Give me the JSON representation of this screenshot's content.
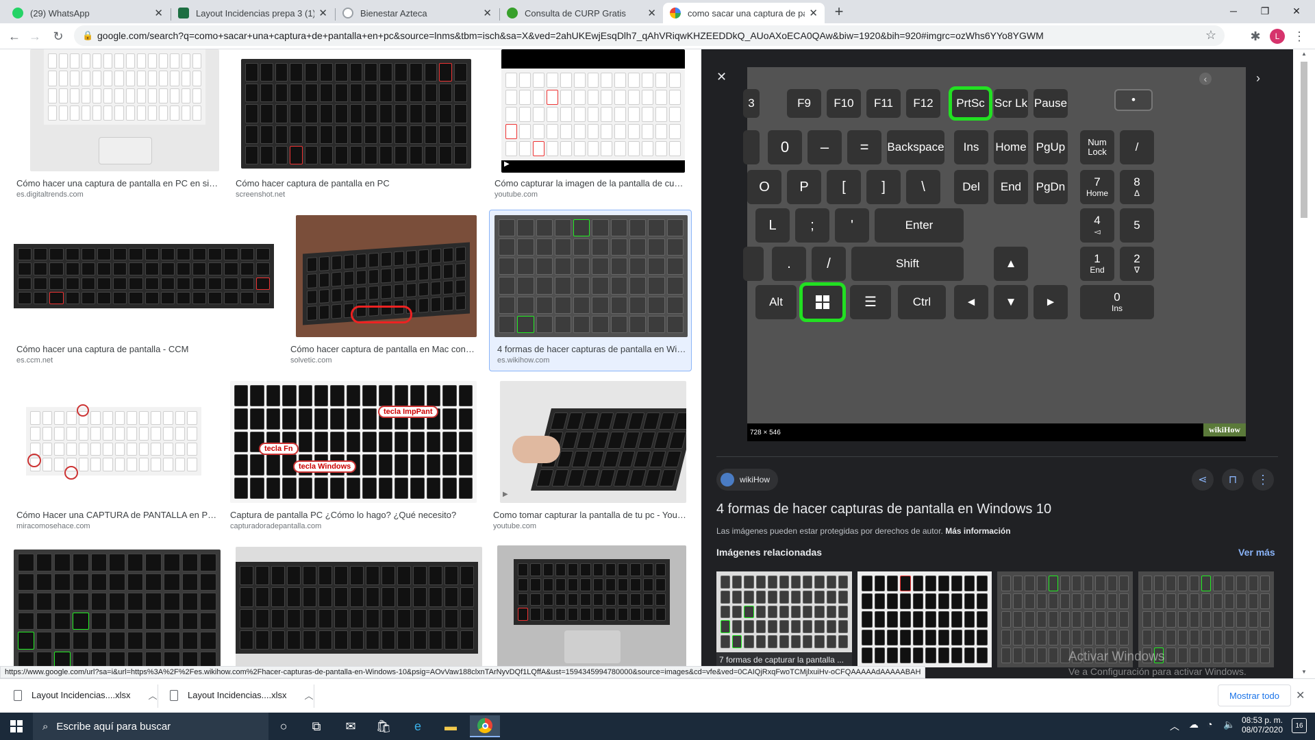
{
  "tabs": [
    {
      "label": "(29) WhatsApp",
      "favicon": "whatsapp-icon",
      "color": "#25d366"
    },
    {
      "label": "Layout Incidencias prepa 3 (1).xls",
      "favicon": "excel-icon",
      "color": "#1d6f42"
    },
    {
      "label": "Bienestar Azteca",
      "favicon": "generic-page-icon",
      "color": "#9aa0a6"
    },
    {
      "label": "Consulta de CURP Gratis",
      "favicon": "globe-icon",
      "color": "#37a02b"
    },
    {
      "label": "como sacar una captura de panta",
      "favicon": "google-icon",
      "color": "#4285f4"
    }
  ],
  "url": "google.com/search?q=como+sacar+una+captura+de+pantalla+en+pc&source=lnms&tbm=isch&sa=X&ved=2ahUKEwjEsqDlh7_qAhVRiqwKHZEEDDkQ_AUoAXoECA0QAw&biw=1920&bih=920#imgrc=ozWhs6YYo8YGWM",
  "profile_initial": "L",
  "results": [
    {
      "title": "Cómo hacer una captura de pantalla en PC en simp...",
      "source": "es.digitaltrends.com"
    },
    {
      "title": "Cómo hacer captura de pantalla en PC",
      "source": "screenshot.net"
    },
    {
      "title": "Cómo capturar la imagen de la pantalla de cualq...",
      "source": "youtube.com"
    },
    {
      "title": "Cómo hacer una captura de pantalla - CCM",
      "source": "es.ccm.net"
    },
    {
      "title": "Cómo hacer captura de pantalla en Mac con tec...",
      "source": "solvetic.com"
    },
    {
      "title": "4 formas de hacer capturas de pantalla en Wind...",
      "source": "es.wikihow.com"
    },
    {
      "title": "Cómo Hacer una CAPTURA de PANTALLA en PC ...",
      "source": "miracomosehace.com"
    },
    {
      "title": "Captura de pantalla PC ¿Cómo lo hago? ¿Qué necesito?",
      "source": "capturadoradepantalla.com"
    },
    {
      "title": "Como tomar capturar la pantalla de tu pc - YouTu...",
      "source": "youtube.com"
    }
  ],
  "thumb_labels": {
    "impr": "tecla ImpPant",
    "fn": "tecla Fn",
    "win": "tecla Windows"
  },
  "panel": {
    "image_size": "728 × 546",
    "watermark": "wikiHow",
    "site": "wikiHow",
    "title": "4 formas de hacer capturas de pantalla en Windows 10",
    "copyright": "Las imágenes pueden estar protegidas por derechos de autor.",
    "more_info": "Más información",
    "related_heading": "Imágenes relacionadas",
    "see_more": "Ver más",
    "related_caption": "7 formas de capturar la pantalla ..."
  },
  "keys": {
    "row1": [
      "3",
      "F9",
      "F10",
      "F11",
      "F12",
      "PrtSc",
      "Scr Lk",
      "Pause"
    ],
    "backspace": "Backspace",
    "ins": "Ins",
    "home": "Home",
    "pgup": "PgUp",
    "numlock": "Num Lock",
    "slash": "/",
    "del": "Del",
    "end": "End",
    "pgdn": "PgDn",
    "enter": "Enter",
    "shift": "Shift",
    "alt": "Alt",
    "ctrl": "Ctrl",
    "num7": "7",
    "num7sub": "Home",
    "num8": "8",
    "num8sub": "Δ",
    "num4": "4",
    "num4sub": "◅",
    "num5": "5",
    "num1": "1",
    "num1sub": "End",
    "num2": "2",
    "num2sub": "∇",
    "num0": "0",
    "num0sub": "Ins",
    "o": "O",
    "p": "P",
    "l": "L",
    "zero": "0"
  },
  "status_url": "https://www.google.com/url?sa=i&url=https%3A%2F%2Fes.wikihow.com%2Fhacer-capturas-de-pantalla-en-Windows-10&psig=AOvVaw188clxnTArNyvDQf1LQffA&ust=1594345994780000&source=images&cd=vfe&ved=0CAIQjRxqFwoTCMjlxuiHv-oCFQAAAAAdAAAAABAH",
  "activation": {
    "line1": "Activar Windows",
    "line2": "Ve a Configuración para activar Windows."
  },
  "downloads": [
    {
      "name": "Layout Incidencias....xlsx"
    },
    {
      "name": "Layout Incidencias....xlsx"
    }
  ],
  "show_all": "Mostrar todo",
  "taskbar": {
    "search_placeholder": "Escribe aquí para buscar",
    "time": "08:53 p. m.",
    "date": "08/07/2020",
    "notifications": "16"
  }
}
